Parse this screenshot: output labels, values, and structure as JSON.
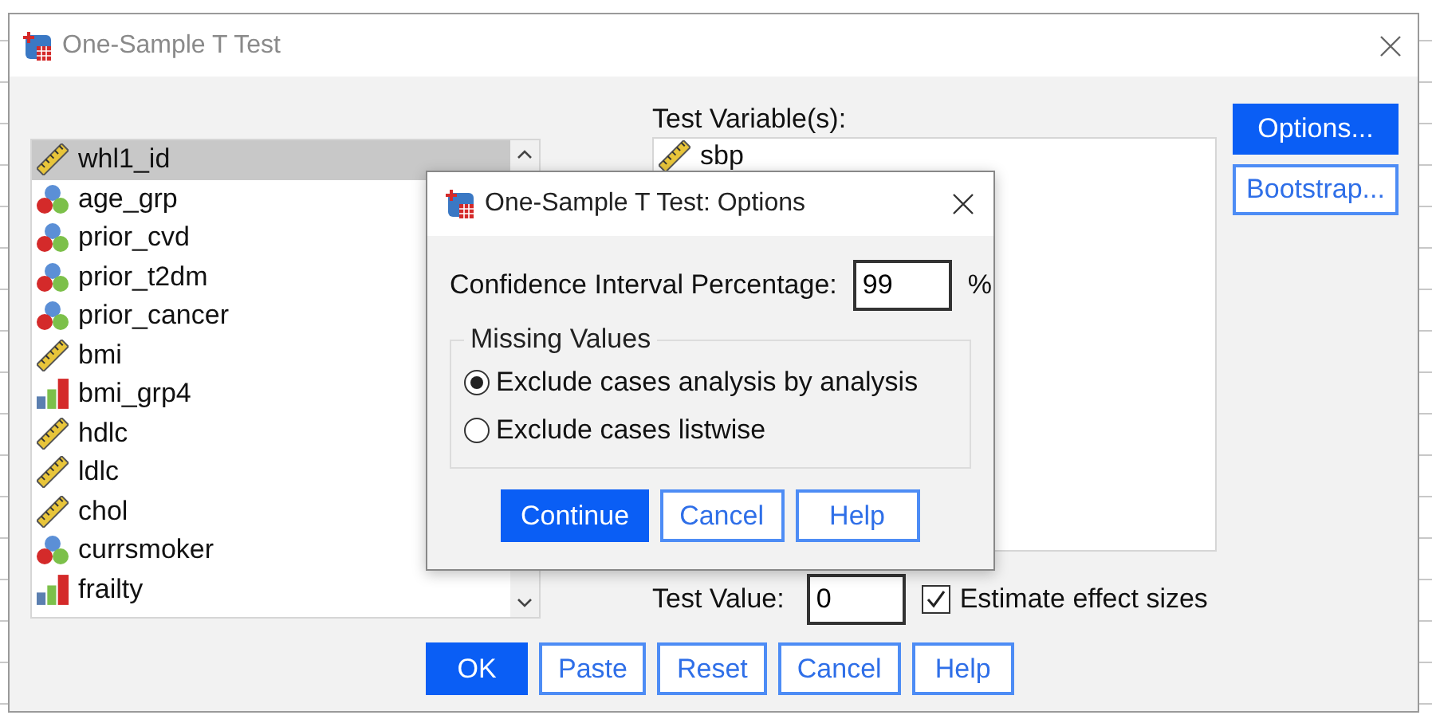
{
  "window": {
    "title": "One-Sample T Test"
  },
  "variables": [
    {
      "name": "whl1_id",
      "kind": "scale",
      "selected": true
    },
    {
      "name": "age_grp",
      "kind": "nominal",
      "selected": false
    },
    {
      "name": "prior_cvd",
      "kind": "nominal",
      "selected": false
    },
    {
      "name": "prior_t2dm",
      "kind": "nominal",
      "selected": false
    },
    {
      "name": "prior_cancer",
      "kind": "nominal",
      "selected": false
    },
    {
      "name": "bmi",
      "kind": "scale",
      "selected": false
    },
    {
      "name": "bmi_grp4",
      "kind": "ordinal",
      "selected": false
    },
    {
      "name": "hdlc",
      "kind": "scale",
      "selected": false
    },
    {
      "name": "ldlc",
      "kind": "scale",
      "selected": false
    },
    {
      "name": "chol",
      "kind": "scale",
      "selected": false
    },
    {
      "name": "currsmoker",
      "kind": "nominal",
      "selected": false
    },
    {
      "name": "frailty",
      "kind": "ordinal",
      "selected": false
    }
  ],
  "test_variables": {
    "label": "Test Variable(s):",
    "items": [
      {
        "name": "sbp",
        "kind": "scale"
      }
    ]
  },
  "side_buttons": [
    {
      "label": "Options...",
      "primary": true
    },
    {
      "label": "Bootstrap...",
      "primary": false
    }
  ],
  "test_value": {
    "label": "Test Value:",
    "value": "0"
  },
  "effect_sizes": {
    "label": "Estimate effect sizes",
    "checked": true
  },
  "buttons": [
    {
      "label": "OK",
      "primary": true
    },
    {
      "label": "Paste",
      "primary": false
    },
    {
      "label": "Reset",
      "primary": false
    },
    {
      "label": "Cancel",
      "primary": false
    },
    {
      "label": "Help",
      "primary": false
    }
  ],
  "options_dialog": {
    "title": "One-Sample T Test: Options",
    "ci_label": "Confidence Interval Percentage:",
    "ci_value": "99",
    "ci_unit": "%",
    "missing_values": {
      "title": "Missing Values",
      "options": [
        {
          "label": "Exclude cases analysis by analysis",
          "selected": true
        },
        {
          "label": "Exclude cases listwise",
          "selected": false
        }
      ]
    },
    "buttons": [
      {
        "label": "Continue",
        "primary": true
      },
      {
        "label": "Cancel",
        "primary": false
      },
      {
        "label": "Help",
        "primary": false
      }
    ]
  }
}
